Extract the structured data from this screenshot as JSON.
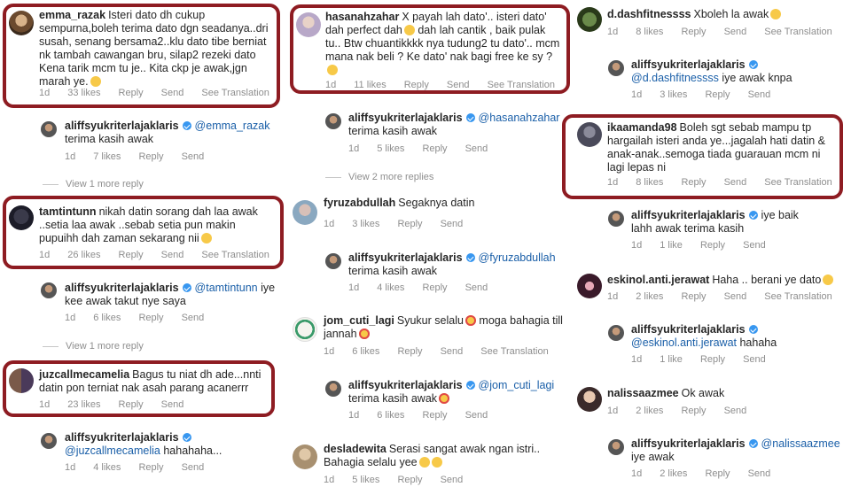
{
  "actions": {
    "reply": "Reply",
    "send": "Send",
    "see_translation": "See Translation"
  },
  "col1": {
    "c1": {
      "user": "emma_razak",
      "text": "Isteri dato dh cukup sempurna,boleh terima dato dgn seadanya..dri susah, senang bersama2..klu dato tibe berniat nk tambah cawangan bru, silap2 rezeki dato Kena tarik mcm tu je.. Kita ckp je awak,jgn marah ye.",
      "time": "1d",
      "likes": "33 likes"
    },
    "r1": {
      "user": "aliffsyukriterlajaklaris",
      "mention": "@emma_razak",
      "text": "terima kasih awak",
      "time": "1d",
      "likes": "7 likes"
    },
    "more1": "View 1 more reply",
    "c2": {
      "user": "tamtintunn",
      "text": "nikah datin sorang dah laa awak ..setia laa awak ..sebab setia pun makin pupuihh dah zaman sekarang nii",
      "time": "1d",
      "likes": "26 likes"
    },
    "r2": {
      "user": "aliffsyukriterlajaklaris",
      "mention": "@tamtintunn",
      "text": "iye kee awak takut nye saya",
      "time": "1d",
      "likes": "6 likes"
    },
    "more2": "View 1 more reply",
    "c3": {
      "user": "juzcallmecamelia",
      "text": "Bagus tu niat dh ade...nnti datin pon terniat nak asah parang acanerrr",
      "time": "1d",
      "likes": "23 likes"
    },
    "r3": {
      "user": "aliffsyukriterlajaklaris",
      "mention": "@juzcallmecamelia",
      "text": "hahahaha...",
      "time": "1d",
      "likes": "4 likes"
    }
  },
  "col2": {
    "c1": {
      "user": "hasanahzahar",
      "text": "X payah lah dato'.. isteri dato' dah perfect dah",
      "text2": "dah lah cantik , baik pulak tu.. Btw chuantikkkk nya tudung2 tu dato'.. mcm mana nak beli ? Ke dato' nak bagi free ke sy ?",
      "time": "1d",
      "likes": "11 likes"
    },
    "r1": {
      "user": "aliffsyukriterlajaklaris",
      "mention": "@hasanahzahar",
      "text": "terima kasih awak",
      "time": "1d",
      "likes": "5 likes"
    },
    "more1": "View 2 more replies",
    "c2": {
      "user": "fyruzabdullah",
      "text": "Segaknya datin",
      "time": "1d",
      "likes": "3 likes"
    },
    "r2": {
      "user": "aliffsyukriterlajaklaris",
      "mention": "@fyruzabdullah",
      "text": "terima kasih awak",
      "time": "1d",
      "likes": "4 likes"
    },
    "c3": {
      "user": "jom_cuti_lagi",
      "text": "Syukur selalu",
      "text2": "moga bahagia till jannah",
      "time": "1d",
      "likes": "6 likes"
    },
    "r3": {
      "user": "aliffsyukriterlajaklaris",
      "mention": "@jom_cuti_lagi",
      "text": "terima kasih awak",
      "time": "1d",
      "likes": "6 likes"
    },
    "c4": {
      "user": "desladewita",
      "text": "Serasi sangat awak ngan istri.. Bahagia selalu yee",
      "time": "1d",
      "likes": "5 likes"
    }
  },
  "col3": {
    "c1": {
      "user": "d.dashfitnessss",
      "text": "Xboleh la awak",
      "time": "1d",
      "likes": "8 likes"
    },
    "r1": {
      "user": "aliffsyukriterlajaklaris",
      "mention": "@d.dashfitnessss",
      "text": "iye awak knpa",
      "time": "1d",
      "likes": "3 likes"
    },
    "c2": {
      "user": "ikaamanda98",
      "text": "Boleh sgt sebab mampu tp hargailah isteri anda ye...jagalah hati datin & anak-anak..semoga tiada guarauan mcm ni lagi lepas ni",
      "time": "1d",
      "likes": "8 likes"
    },
    "r2": {
      "user": "aliffsyukriterlajaklaris",
      "text": "iye baik lahh awak terima kasih",
      "time": "1d",
      "likes": "1 like"
    },
    "c3": {
      "user": "eskinol.anti.jerawat",
      "text": "Haha .. berani ye dato",
      "time": "1d",
      "likes": "2 likes"
    },
    "r3": {
      "user": "aliffsyukriterlajaklaris",
      "mention": "@eskinol.anti.jerawat",
      "text": "hahaha",
      "time": "1d",
      "likes": "1 like"
    },
    "c4": {
      "user": "nalissaazmee",
      "text": "Ok awak",
      "time": "1d",
      "likes": "2 likes"
    },
    "r4": {
      "user": "aliffsyukriterlajaklaris",
      "mention": "@nalissaazmee",
      "text": "iye awak",
      "time": "1d",
      "likes": "2 likes"
    }
  }
}
